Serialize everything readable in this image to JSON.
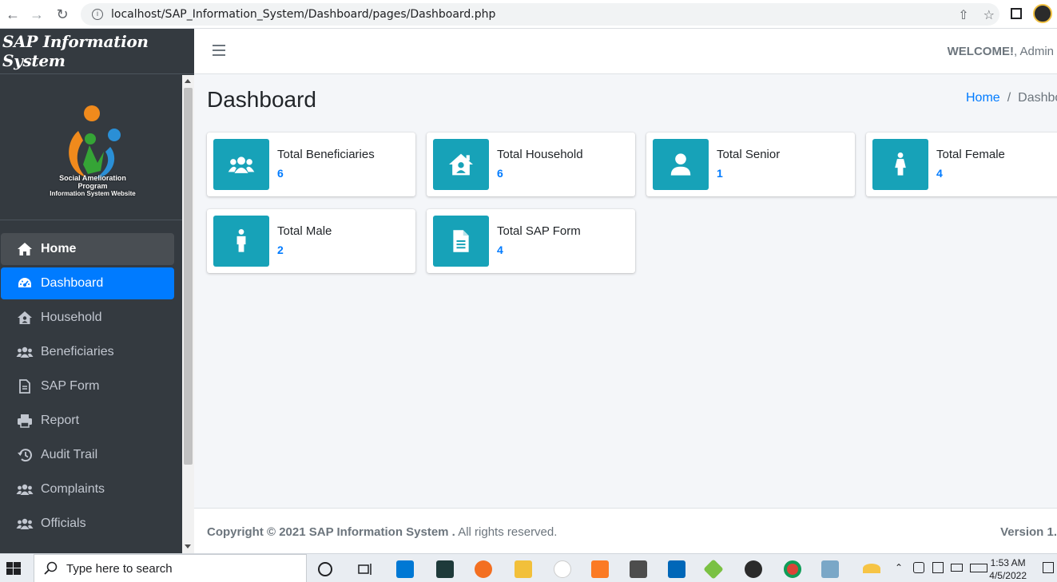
{
  "browser": {
    "url": "localhost/SAP_Information_System/Dashboard/pages/Dashboard.php"
  },
  "brand": {
    "title": "SAP Information System"
  },
  "logo": {
    "line1": "Social Amelioration Program",
    "line2": "Information System Website"
  },
  "sidebar": {
    "items": [
      {
        "label": "Home",
        "icon": "home-icon"
      },
      {
        "label": "Dashboard",
        "icon": "dashboard-icon"
      },
      {
        "label": "Household",
        "icon": "house-user-icon"
      },
      {
        "label": "Beneficiaries",
        "icon": "users-icon"
      },
      {
        "label": "SAP Form",
        "icon": "file-icon"
      },
      {
        "label": "Report",
        "icon": "print-icon"
      },
      {
        "label": "Audit Trail",
        "icon": "history-icon"
      },
      {
        "label": "Complaints",
        "icon": "users-icon"
      },
      {
        "label": "Officials",
        "icon": "users-icon"
      }
    ]
  },
  "header": {
    "welcome": "WELCOME!",
    "user": ", Admin"
  },
  "main": {
    "title": "Dashboard",
    "breadcrumb": {
      "home": "Home",
      "sep": "/",
      "current": "Dashboard"
    },
    "cards": [
      {
        "label": "Total Beneficiaries",
        "value": "6",
        "icon": "users-icon"
      },
      {
        "label": "Total Household",
        "value": "6",
        "icon": "house-user-icon"
      },
      {
        "label": "Total Senior",
        "value": "1",
        "icon": "user-icon"
      },
      {
        "label": "Total Female",
        "value": "4",
        "icon": "female-icon"
      },
      {
        "label": "Total Male",
        "value": "2",
        "icon": "male-icon"
      },
      {
        "label": "Total SAP Form",
        "value": "4",
        "icon": "file-alt-icon"
      }
    ]
  },
  "footer": {
    "copyright": "Copyright © 2021 SAP Information System .",
    "rights": " All rights reserved.",
    "version": "Version 1."
  },
  "taskbar": {
    "search_placeholder": "Type here to search",
    "time": "1:53 AM",
    "date": "4/5/2022"
  },
  "colors": {
    "accent": "#007bff",
    "sidebar": "#343a40",
    "info": "#17a2b8"
  }
}
